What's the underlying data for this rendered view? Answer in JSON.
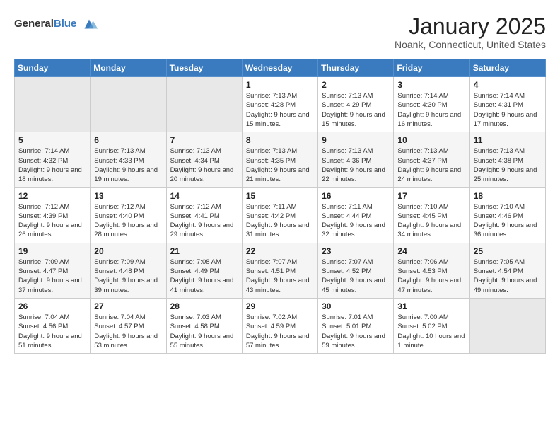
{
  "logo": {
    "general": "General",
    "blue": "Blue"
  },
  "header": {
    "month": "January 2025",
    "location": "Noank, Connecticut, United States"
  },
  "weekdays": [
    "Sunday",
    "Monday",
    "Tuesday",
    "Wednesday",
    "Thursday",
    "Friday",
    "Saturday"
  ],
  "weeks": [
    [
      {
        "day": "",
        "sunrise": "",
        "sunset": "",
        "daylight": ""
      },
      {
        "day": "",
        "sunrise": "",
        "sunset": "",
        "daylight": ""
      },
      {
        "day": "",
        "sunrise": "",
        "sunset": "",
        "daylight": ""
      },
      {
        "day": "1",
        "sunrise": "Sunrise: 7:13 AM",
        "sunset": "Sunset: 4:28 PM",
        "daylight": "Daylight: 9 hours and 15 minutes."
      },
      {
        "day": "2",
        "sunrise": "Sunrise: 7:13 AM",
        "sunset": "Sunset: 4:29 PM",
        "daylight": "Daylight: 9 hours and 15 minutes."
      },
      {
        "day": "3",
        "sunrise": "Sunrise: 7:14 AM",
        "sunset": "Sunset: 4:30 PM",
        "daylight": "Daylight: 9 hours and 16 minutes."
      },
      {
        "day": "4",
        "sunrise": "Sunrise: 7:14 AM",
        "sunset": "Sunset: 4:31 PM",
        "daylight": "Daylight: 9 hours and 17 minutes."
      }
    ],
    [
      {
        "day": "5",
        "sunrise": "Sunrise: 7:14 AM",
        "sunset": "Sunset: 4:32 PM",
        "daylight": "Daylight: 9 hours and 18 minutes."
      },
      {
        "day": "6",
        "sunrise": "Sunrise: 7:13 AM",
        "sunset": "Sunset: 4:33 PM",
        "daylight": "Daylight: 9 hours and 19 minutes."
      },
      {
        "day": "7",
        "sunrise": "Sunrise: 7:13 AM",
        "sunset": "Sunset: 4:34 PM",
        "daylight": "Daylight: 9 hours and 20 minutes."
      },
      {
        "day": "8",
        "sunrise": "Sunrise: 7:13 AM",
        "sunset": "Sunset: 4:35 PM",
        "daylight": "Daylight: 9 hours and 21 minutes."
      },
      {
        "day": "9",
        "sunrise": "Sunrise: 7:13 AM",
        "sunset": "Sunset: 4:36 PM",
        "daylight": "Daylight: 9 hours and 22 minutes."
      },
      {
        "day": "10",
        "sunrise": "Sunrise: 7:13 AM",
        "sunset": "Sunset: 4:37 PM",
        "daylight": "Daylight: 9 hours and 24 minutes."
      },
      {
        "day": "11",
        "sunrise": "Sunrise: 7:13 AM",
        "sunset": "Sunset: 4:38 PM",
        "daylight": "Daylight: 9 hours and 25 minutes."
      }
    ],
    [
      {
        "day": "12",
        "sunrise": "Sunrise: 7:12 AM",
        "sunset": "Sunset: 4:39 PM",
        "daylight": "Daylight: 9 hours and 26 minutes."
      },
      {
        "day": "13",
        "sunrise": "Sunrise: 7:12 AM",
        "sunset": "Sunset: 4:40 PM",
        "daylight": "Daylight: 9 hours and 28 minutes."
      },
      {
        "day": "14",
        "sunrise": "Sunrise: 7:12 AM",
        "sunset": "Sunset: 4:41 PM",
        "daylight": "Daylight: 9 hours and 29 minutes."
      },
      {
        "day": "15",
        "sunrise": "Sunrise: 7:11 AM",
        "sunset": "Sunset: 4:42 PM",
        "daylight": "Daylight: 9 hours and 31 minutes."
      },
      {
        "day": "16",
        "sunrise": "Sunrise: 7:11 AM",
        "sunset": "Sunset: 4:44 PM",
        "daylight": "Daylight: 9 hours and 32 minutes."
      },
      {
        "day": "17",
        "sunrise": "Sunrise: 7:10 AM",
        "sunset": "Sunset: 4:45 PM",
        "daylight": "Daylight: 9 hours and 34 minutes."
      },
      {
        "day": "18",
        "sunrise": "Sunrise: 7:10 AM",
        "sunset": "Sunset: 4:46 PM",
        "daylight": "Daylight: 9 hours and 36 minutes."
      }
    ],
    [
      {
        "day": "19",
        "sunrise": "Sunrise: 7:09 AM",
        "sunset": "Sunset: 4:47 PM",
        "daylight": "Daylight: 9 hours and 37 minutes."
      },
      {
        "day": "20",
        "sunrise": "Sunrise: 7:09 AM",
        "sunset": "Sunset: 4:48 PM",
        "daylight": "Daylight: 9 hours and 39 minutes."
      },
      {
        "day": "21",
        "sunrise": "Sunrise: 7:08 AM",
        "sunset": "Sunset: 4:49 PM",
        "daylight": "Daylight: 9 hours and 41 minutes."
      },
      {
        "day": "22",
        "sunrise": "Sunrise: 7:07 AM",
        "sunset": "Sunset: 4:51 PM",
        "daylight": "Daylight: 9 hours and 43 minutes."
      },
      {
        "day": "23",
        "sunrise": "Sunrise: 7:07 AM",
        "sunset": "Sunset: 4:52 PM",
        "daylight": "Daylight: 9 hours and 45 minutes."
      },
      {
        "day": "24",
        "sunrise": "Sunrise: 7:06 AM",
        "sunset": "Sunset: 4:53 PM",
        "daylight": "Daylight: 9 hours and 47 minutes."
      },
      {
        "day": "25",
        "sunrise": "Sunrise: 7:05 AM",
        "sunset": "Sunset: 4:54 PM",
        "daylight": "Daylight: 9 hours and 49 minutes."
      }
    ],
    [
      {
        "day": "26",
        "sunrise": "Sunrise: 7:04 AM",
        "sunset": "Sunset: 4:56 PM",
        "daylight": "Daylight: 9 hours and 51 minutes."
      },
      {
        "day": "27",
        "sunrise": "Sunrise: 7:04 AM",
        "sunset": "Sunset: 4:57 PM",
        "daylight": "Daylight: 9 hours and 53 minutes."
      },
      {
        "day": "28",
        "sunrise": "Sunrise: 7:03 AM",
        "sunset": "Sunset: 4:58 PM",
        "daylight": "Daylight: 9 hours and 55 minutes."
      },
      {
        "day": "29",
        "sunrise": "Sunrise: 7:02 AM",
        "sunset": "Sunset: 4:59 PM",
        "daylight": "Daylight: 9 hours and 57 minutes."
      },
      {
        "day": "30",
        "sunrise": "Sunrise: 7:01 AM",
        "sunset": "Sunset: 5:01 PM",
        "daylight": "Daylight: 9 hours and 59 minutes."
      },
      {
        "day": "31",
        "sunrise": "Sunrise: 7:00 AM",
        "sunset": "Sunset: 5:02 PM",
        "daylight": "Daylight: 10 hours and 1 minute."
      },
      {
        "day": "",
        "sunrise": "",
        "sunset": "",
        "daylight": ""
      }
    ]
  ]
}
